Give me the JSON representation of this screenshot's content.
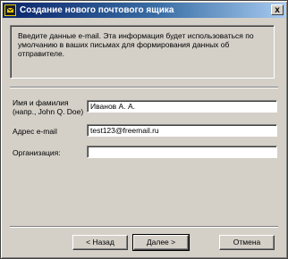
{
  "window": {
    "title": "Создание нового почтового ящика",
    "close_glyph": "x",
    "icon": "mail-account-icon"
  },
  "info": {
    "text": "Введите данные e-mail. Эта информация будет использоваться по умолчанию в ваших письмах для формирования данных об отправителе."
  },
  "fields": {
    "name_label": "Имя и фамилия (напр., John Q. Doe)",
    "name_value": "Иванов А. А.",
    "email_label": "Адрес e-mail",
    "email_value": "test123@freemail.ru",
    "org_label": "Организация:",
    "org_value": ""
  },
  "buttons": {
    "back": "< Назад",
    "next": "Далее >",
    "cancel": "Отмена"
  }
}
